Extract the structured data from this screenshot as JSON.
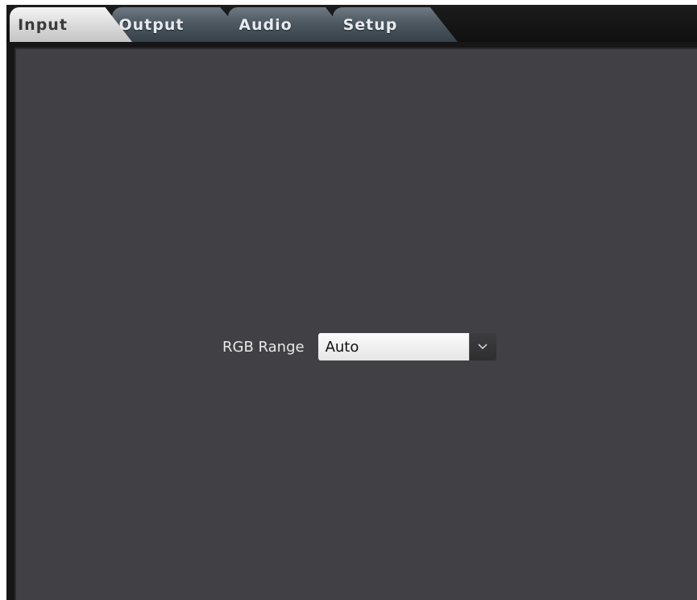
{
  "tabs": [
    {
      "label": "Input",
      "active": true
    },
    {
      "label": "Output",
      "active": false
    },
    {
      "label": "Audio",
      "active": false
    },
    {
      "label": "Setup",
      "active": false
    }
  ],
  "input_panel": {
    "rgb_range": {
      "label": "RGB Range",
      "selected_value": "Auto",
      "arrow_icon": "chevron-down-icon"
    }
  },
  "colors": {
    "panel_background": "#414145",
    "active_tab": "#e0e0e0",
    "inactive_tab": "#4d5860"
  }
}
